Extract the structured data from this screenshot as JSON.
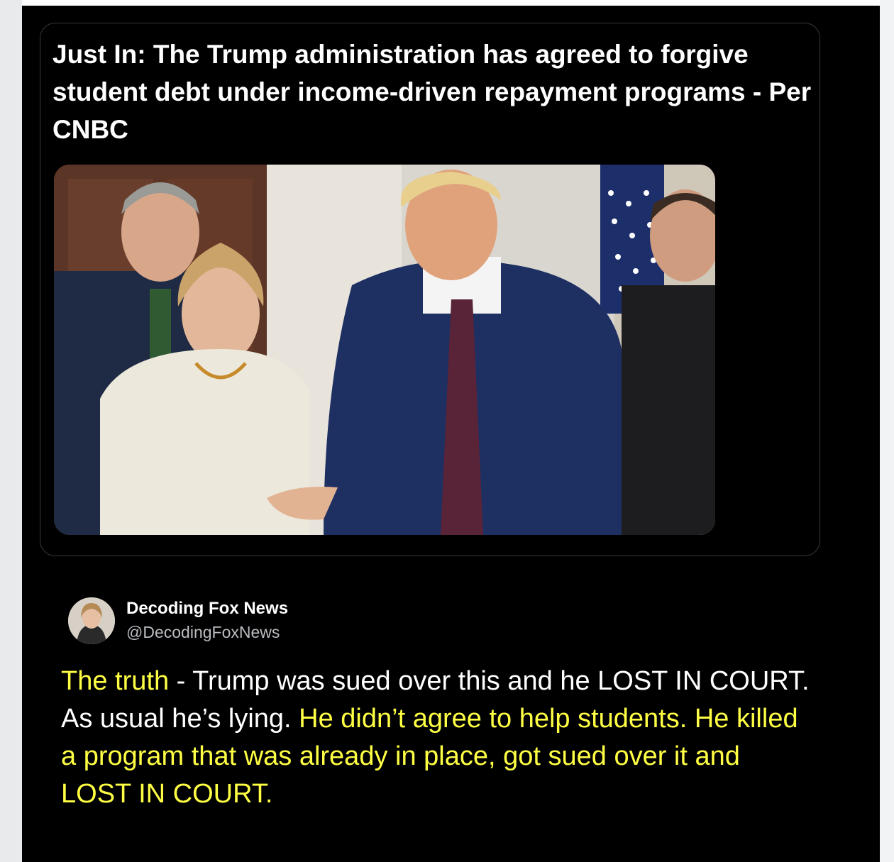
{
  "quote": {
    "text": "Just In: The Trump administration has agreed to forgive student debt under income-driven repayment programs  - Per CNBC"
  },
  "photo": {
    "alt": "Photo of Trump holding hands with a woman in a white jacket, with men in suits and an American flag in the background"
  },
  "author": {
    "name": "Decoding Fox News",
    "handle": "@DecodingFoxNews"
  },
  "commentary": {
    "part1_highlight": "The truth",
    "part2": " - Trump was sued over this and he LOST IN COURT.  As usual he’s lying.  ",
    "part3_highlight": "He didn’t agree to help students. He killed a program that was already in place, got sued over it and LOST IN COURT."
  },
  "colors": {
    "background": "#000000",
    "highlight": "#ffff44",
    "text": "#ffffff",
    "handle": "#b9bcc0"
  }
}
